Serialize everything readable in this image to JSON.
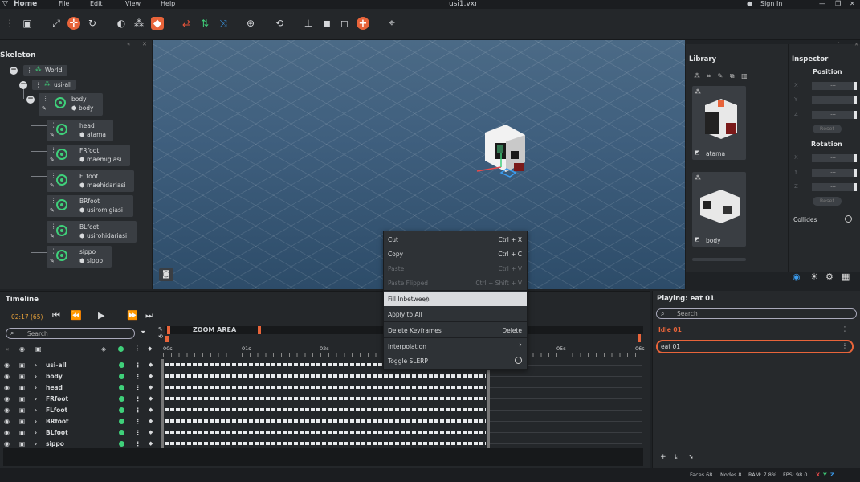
{
  "menu": {
    "home": "Home",
    "file": "File",
    "edit": "Edit",
    "view": "View",
    "help": "Help",
    "title": "usi1.vxr",
    "sign_in": "Sign In"
  },
  "skeleton": {
    "title": "Skeleton",
    "nodes": [
      {
        "name": "World"
      },
      {
        "name": "usi-all"
      },
      {
        "name": "body",
        "mesh": "body"
      },
      {
        "name": "head",
        "mesh": "atama"
      },
      {
        "name": "FRfoot",
        "mesh": "maemigiasi"
      },
      {
        "name": "FLfoot",
        "mesh": "maehidariasi"
      },
      {
        "name": "BRfoot",
        "mesh": "usiromigiasi"
      },
      {
        "name": "BLfoot",
        "mesh": "usirohidariasi"
      },
      {
        "name": "sippo",
        "mesh": "sippo"
      }
    ]
  },
  "library": {
    "title": "Library",
    "items": [
      {
        "label": "atama"
      },
      {
        "label": "body"
      }
    ]
  },
  "inspector": {
    "title": "Inspector",
    "position_label": "Position",
    "rotation_label": "Rotation",
    "axes": [
      "X",
      "Y",
      "Z"
    ],
    "field_value": "---",
    "reset_label": "Reset",
    "collides_label": "Collides"
  },
  "context_menu": {
    "items": [
      {
        "label": "Cut",
        "shortcut": "Ctrl + X"
      },
      {
        "label": "Copy",
        "shortcut": "Ctrl + C"
      },
      {
        "label": "Paste",
        "shortcut": "Ctrl + V"
      },
      {
        "label": "Paste Flipped",
        "shortcut": "Ctrl + Shift + V"
      },
      {
        "label": "Fill Inbetween",
        "shortcut": ""
      },
      {
        "label": "Apply to All",
        "shortcut": ""
      },
      {
        "label": "Delete Keyframes",
        "shortcut": "Delete"
      },
      {
        "label": "Interpolation",
        "shortcut": ""
      },
      {
        "label": "Toggle SLERP",
        "shortcut": ""
      }
    ]
  },
  "timeline": {
    "title": "Timeline",
    "time": "02:17 (65)",
    "search_placeholder": "Search",
    "zoom_area": "ZOOM AREA",
    "ticks": [
      "00s",
      "01s",
      "02s",
      "05s",
      "06s"
    ],
    "rows": [
      "usi-all",
      "body",
      "head",
      "FRfoot",
      "FLfoot",
      "BRfoot",
      "BLfoot",
      "sippo"
    ]
  },
  "playing": {
    "title": "Playing: eat 01",
    "search_placeholder": "Search",
    "animations": [
      "Idle 01",
      "eat 01"
    ]
  },
  "status": {
    "faces": "Faces 68",
    "nodes": "Nodes 8",
    "ram": "RAM: 7.8%",
    "fps": "FPS: 98.0",
    "x": "X",
    "y": "Y",
    "z": "Z"
  },
  "colors": {
    "accent": "#e8643a",
    "green": "#3fd07a",
    "blue": "#3b9df0"
  }
}
